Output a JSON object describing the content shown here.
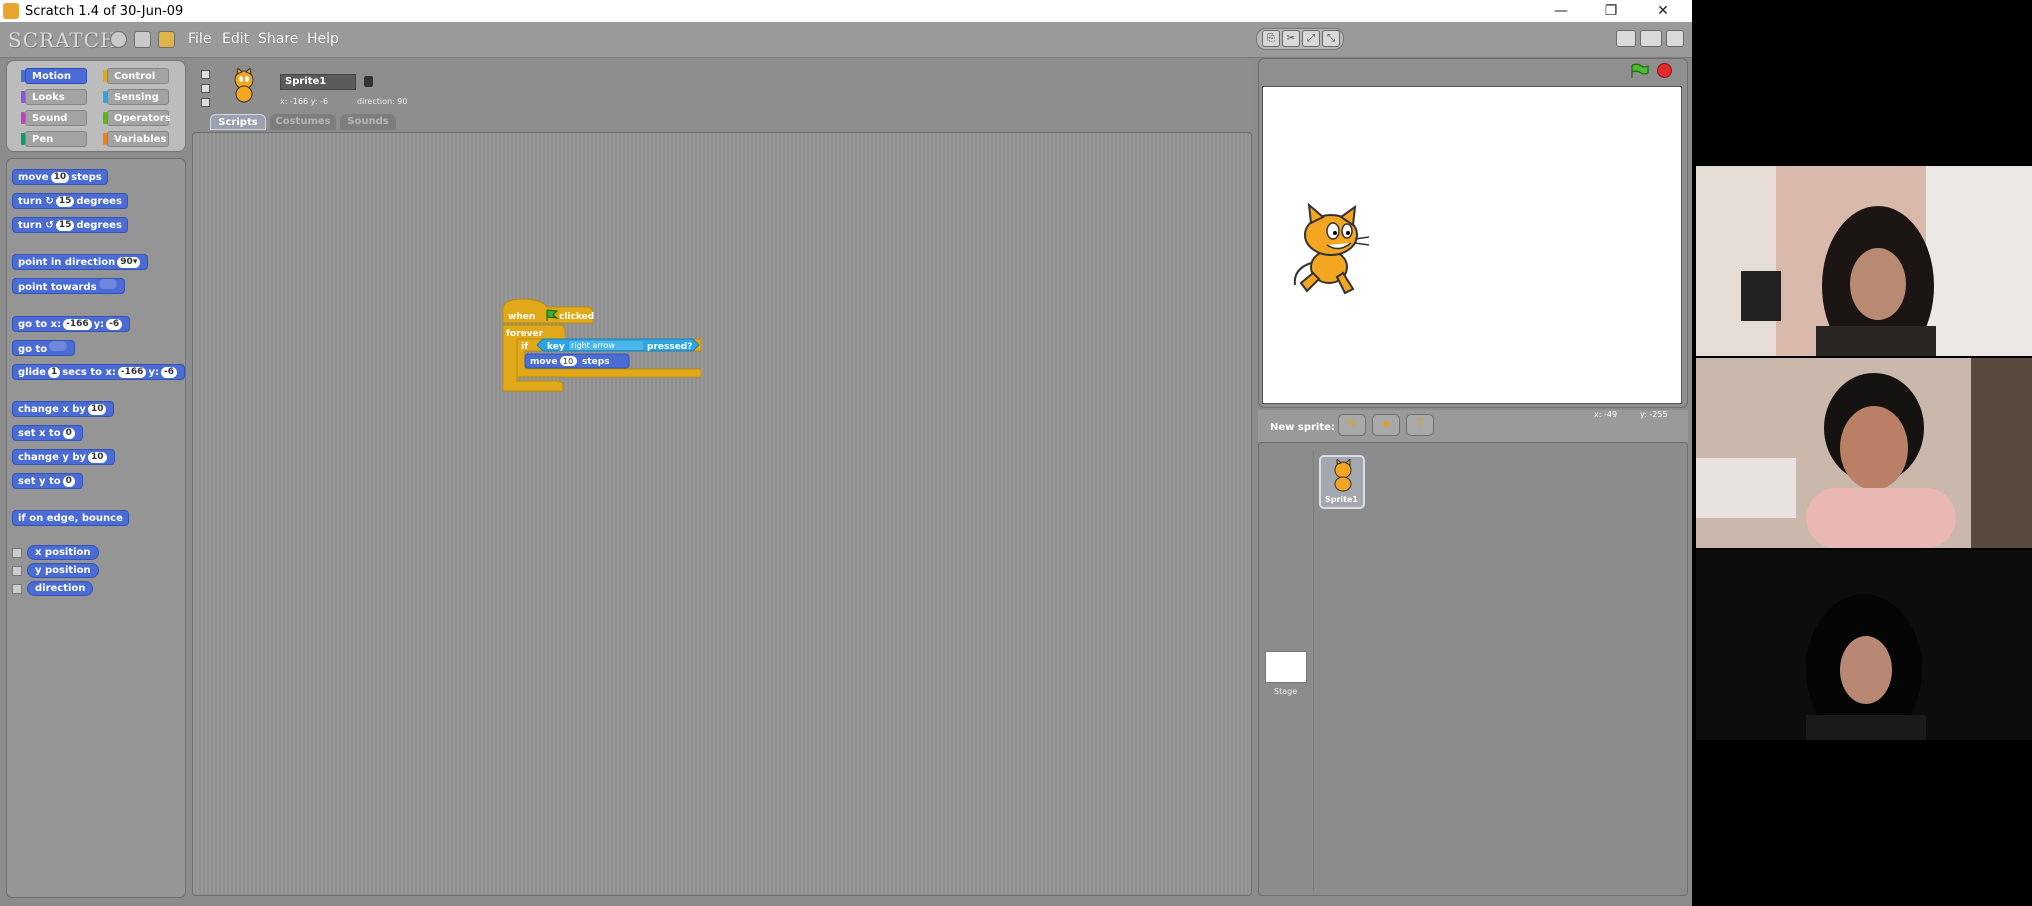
{
  "window": {
    "title": "Scratch 1.4 of 30-Jun-09",
    "controls": {
      "minimize": "—",
      "restore": "❐",
      "close": "✕"
    }
  },
  "menubar": {
    "logo": "SCRATCH",
    "menus": [
      "File",
      "Edit",
      "Share",
      "Help"
    ]
  },
  "categories": [
    {
      "label": "Motion",
      "color": "#4a6cd4"
    },
    {
      "label": "Control",
      "color": "#e1a91a"
    },
    {
      "label": "Looks",
      "color": "#8a55d7"
    },
    {
      "label": "Sensing",
      "color": "#2ca5e2"
    },
    {
      "label": "Sound",
      "color": "#bb42c3"
    },
    {
      "label": "Operators",
      "color": "#5cb712"
    },
    {
      "label": "Pen",
      "color": "#0e9a6c"
    },
    {
      "label": "Variables",
      "color": "#ee7d16"
    }
  ],
  "palette": {
    "move": {
      "pre": "move",
      "value": "10",
      "post": "steps"
    },
    "turn_cw": {
      "pre": "turn ↻",
      "value": "15",
      "post": "degrees"
    },
    "turn_ccw": {
      "pre": "turn ↺",
      "value": "15",
      "post": "degrees"
    },
    "point_dir": {
      "pre": "point in direction",
      "value": "90▾"
    },
    "point_towards": {
      "pre": "point towards"
    },
    "goto_xy": {
      "pre": "go to x:",
      "x": "-166",
      "ymid": "y:",
      "y": "-6"
    },
    "goto": {
      "pre": "go to"
    },
    "glide": {
      "pre": "glide",
      "secs": "1",
      "mid": "secs to x:",
      "x": "-166",
      "ymid": "y:",
      "y": "-6"
    },
    "change_x": {
      "pre": "change x by",
      "value": "10"
    },
    "set_x": {
      "pre": "set x to",
      "value": "0"
    },
    "change_y": {
      "pre": "change y by",
      "value": "10"
    },
    "set_y": {
      "pre": "set y to",
      "value": "0"
    },
    "bounce": "if on edge, bounce",
    "reporters": [
      "x position",
      "y position",
      "direction"
    ]
  },
  "sprite": {
    "name": "Sprite1",
    "coords": "x: -166  y: -6",
    "direction": "direction: 90"
  },
  "tabs": [
    "Scripts",
    "Costumes",
    "Sounds"
  ],
  "script": {
    "when": "when",
    "clicked": "clicked",
    "forever": "forever",
    "if": "if",
    "key": "key",
    "key_name": "right arrow",
    "pressed": "pressed?",
    "move": "move",
    "move_value": "10",
    "steps": "steps"
  },
  "new_sprite_label": "New sprite:",
  "mouse_x": "x: -49",
  "mouse_y": "y: -255",
  "sprite_thumb_label": "Sprite1",
  "stage_label": "Stage"
}
